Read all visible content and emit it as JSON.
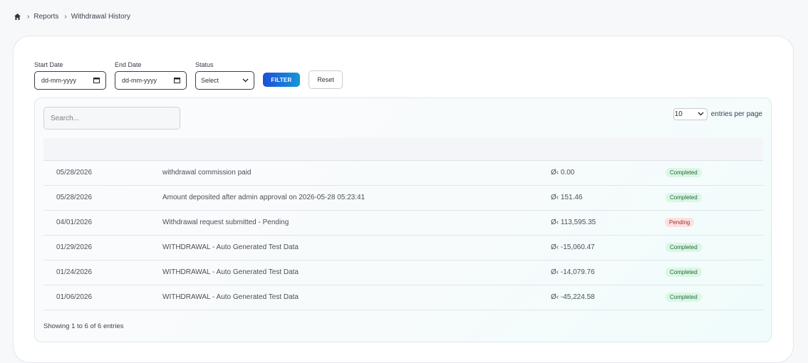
{
  "breadcrumb": {
    "items": [
      "Reports",
      "Withdrawal History"
    ]
  },
  "filters": {
    "start_date_label": "Start Date",
    "start_date_placeholder": "dd-mm-yyyy",
    "end_date_label": "End Date",
    "end_date_placeholder": "dd-mm-yyyy",
    "status_label": "Status",
    "status_value": "Select",
    "filter_button": "FILTER",
    "reset_button": "Reset"
  },
  "table": {
    "search_placeholder": "Search...",
    "entries_value": "10",
    "entries_label": "entries per page",
    "rows": [
      {
        "date": "05/28/2026",
        "description": "withdrawal commission paid",
        "amount": "Ø‹ 0.00",
        "status": "Completed"
      },
      {
        "date": "05/28/2026",
        "description": "Amount deposited after admin approval on 2026-05-28 05:23:41",
        "amount": "Ø‹ 151.46",
        "status": "Completed"
      },
      {
        "date": "04/01/2026",
        "description": "Withdrawal request submitted - Pending",
        "amount": "Ø‹ 113,595.35",
        "status": "Pending"
      },
      {
        "date": "01/29/2026",
        "description": "WITHDRAWAL - Auto Generated Test Data",
        "amount": "Ø‹ -15,060.47",
        "status": "Completed"
      },
      {
        "date": "01/24/2026",
        "description": "WITHDRAWAL - Auto Generated Test Data",
        "amount": "Ø‹ -14,079.76",
        "status": "Completed"
      },
      {
        "date": "01/06/2026",
        "description": "WITHDRAWAL - Auto Generated Test Data",
        "amount": "Ø‹ -45,224.58",
        "status": "Completed"
      }
    ],
    "footer": "Showing 1 to 6 of 6 entries"
  },
  "colors": {
    "completed_bg": "#dcf6e4",
    "pending_bg": "#fde0e0",
    "filter_gradient_start": "#1e4fd6",
    "filter_gradient_end": "#1697d8"
  }
}
